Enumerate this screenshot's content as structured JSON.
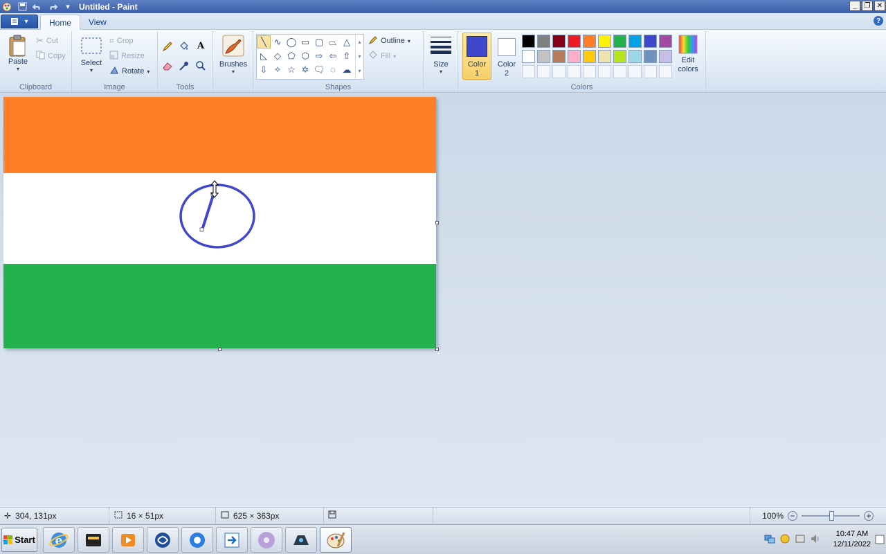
{
  "window": {
    "title": "Untitled - Paint",
    "buttons": [
      "_",
      "❐",
      "✕"
    ]
  },
  "tabs": {
    "app_menu": "▾",
    "home": "Home",
    "view": "View",
    "help": "?"
  },
  "ribbon": {
    "clipboard": {
      "label": "Clipboard",
      "paste": "Paste",
      "cut": "Cut",
      "copy": "Copy"
    },
    "image": {
      "label": "Image",
      "select": "Select",
      "crop": "Crop",
      "resize": "Resize",
      "rotate": "Rotate"
    },
    "tools": {
      "label": "Tools"
    },
    "brushes": {
      "label": "Brushes"
    },
    "shapes": {
      "label": "Shapes",
      "outline": "Outline",
      "fill": "Fill"
    },
    "size": {
      "label": "Size"
    },
    "colors": {
      "label": "Colors",
      "color1": "Color 1",
      "color2": "Color 2",
      "edit": "Edit colors",
      "color1_value": "#3f48cc",
      "color2_value": "#ffffff",
      "palette_row1": [
        "#000000",
        "#7f7f7f",
        "#880015",
        "#ed1c24",
        "#ff7f27",
        "#fff200",
        "#22b14c",
        "#00a2e8",
        "#3f48cc",
        "#a349a4"
      ],
      "palette_row2": [
        "#ffffff",
        "#c3c3c3",
        "#b97a57",
        "#ffaec9",
        "#ffc90e",
        "#efe4b0",
        "#b5e61d",
        "#99d9ea",
        "#7092be",
        "#c8bfe7"
      ]
    }
  },
  "canvas": {
    "flag_colors": {
      "top": "#ff7f27",
      "middle": "#ffffff",
      "bottom": "#22b14c",
      "emblem": "#3f48cc"
    }
  },
  "status": {
    "cursor_pos": "304, 131px",
    "selection_size": "16 × 51px",
    "canvas_size": "625 × 363px",
    "zoom": "100%"
  },
  "taskbar": {
    "start": "Start",
    "time": "10:47 AM",
    "date": "12/11/2022"
  }
}
